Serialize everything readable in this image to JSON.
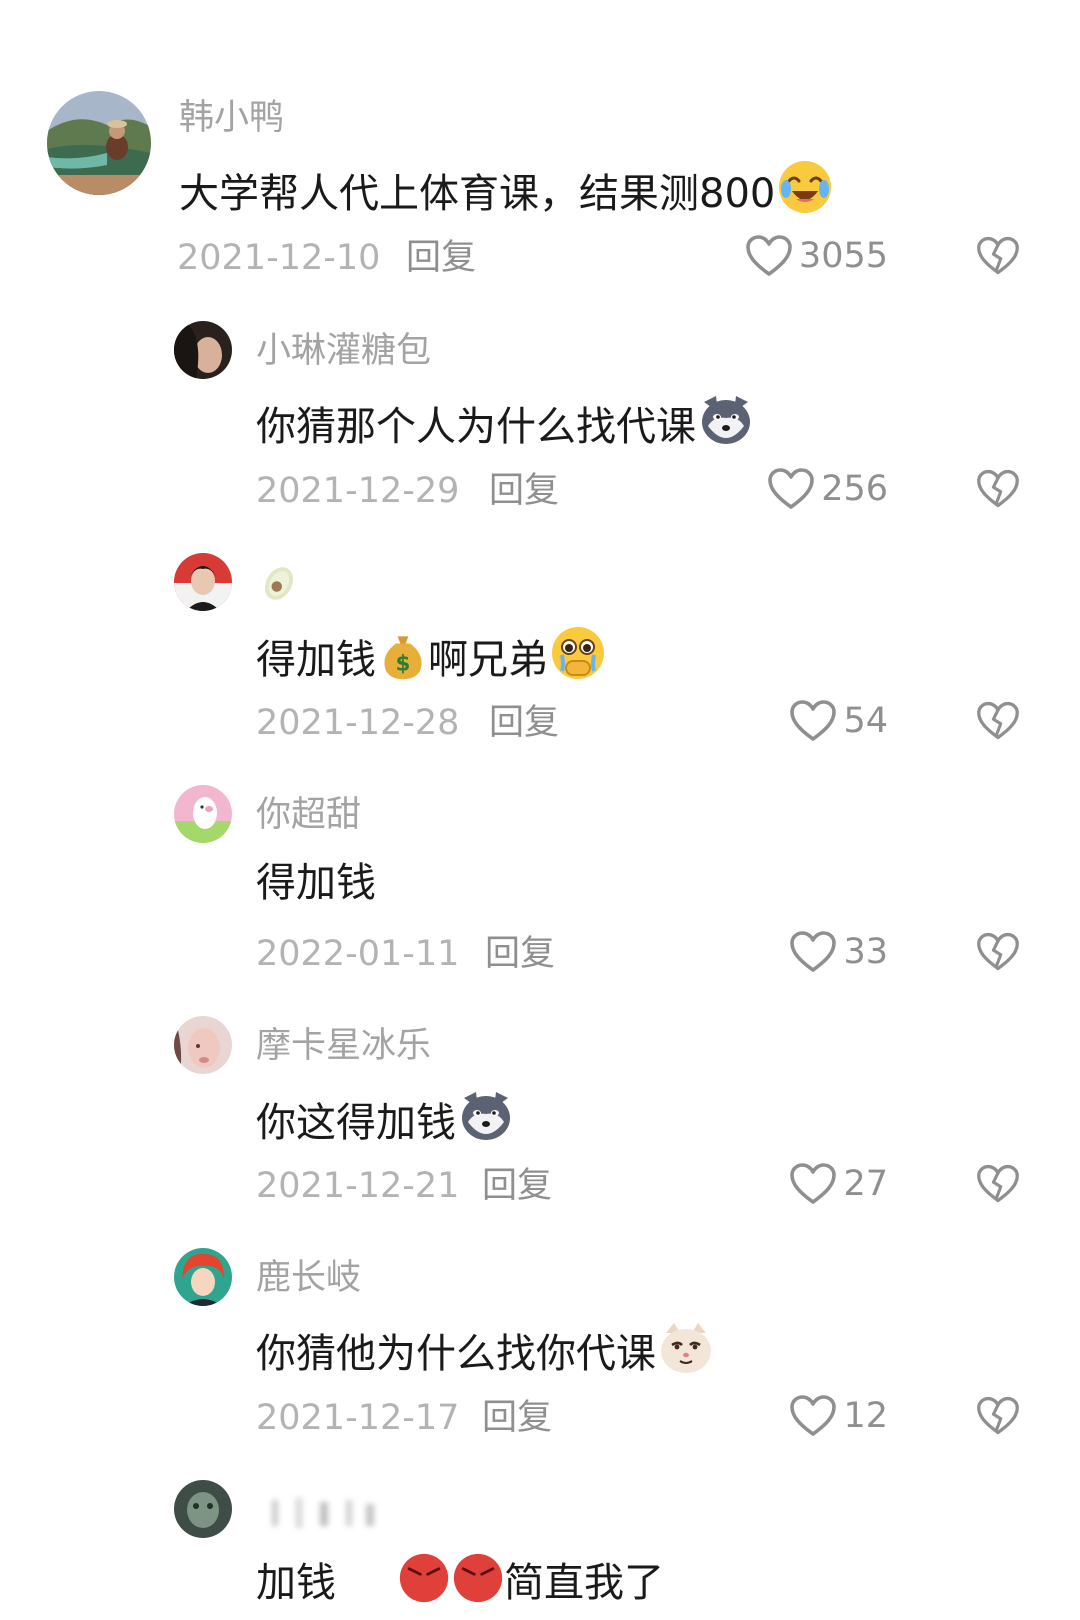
{
  "reply_label": "回复",
  "comments": [
    {
      "user": "韩小鸭",
      "text": "大学帮人代上体育课，结果测800",
      "emoji": "crying-laughing-emoji",
      "date": "2021-12-10",
      "likes": "3055"
    },
    {
      "user": "小琳灌糖包",
      "text": "你猜那个人为什么找代课",
      "emoji": "husky-emoji",
      "date": "2021-12-29",
      "likes": "256"
    },
    {
      "user": "",
      "user_emoji": "avocado-emoji",
      "text_parts": [
        "得加钱",
        "啊兄弟"
      ],
      "emoji_mid": "money-bag-emoji",
      "emoji": "holding-back-tears-emoji",
      "date": "2021-12-28",
      "likes": "54"
    },
    {
      "user": "你超甜",
      "text": "得加钱",
      "date": "2022-01-11",
      "likes": "33"
    },
    {
      "user": "摩卡星冰乐",
      "text": "你这得加钱",
      "emoji": "husky-emoji",
      "date": "2021-12-21",
      "likes": "27"
    },
    {
      "user": "鹿长岐",
      "text": "你猜他为什么找你代课",
      "emoji": "smug-cat-emoji",
      "date": "2021-12-17",
      "likes": "12"
    },
    {
      "user": "",
      "text_parts": [
        "加钱",
        "简直我了"
      ],
      "emoji": "angry-face-emoji"
    }
  ],
  "colors": {
    "text": "#1a1a1a",
    "username": "#a3a3a3",
    "meta": "#b3b3b3",
    "icon": "#8f8f8f"
  }
}
